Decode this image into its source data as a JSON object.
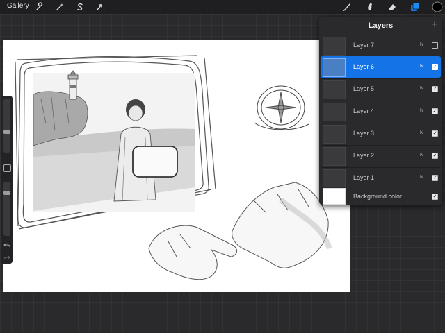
{
  "topbar": {
    "gallery_label": "Gallery",
    "left_tools": [
      {
        "name": "actions",
        "icon": "wrench-icon"
      },
      {
        "name": "adjustments",
        "icon": "magic-wand-icon"
      },
      {
        "name": "selection",
        "icon": "selection-s-icon"
      },
      {
        "name": "transform",
        "icon": "arrow-cursor-icon"
      }
    ],
    "right_tools": [
      {
        "name": "brush",
        "icon": "brush-icon"
      },
      {
        "name": "smudge",
        "icon": "smudge-icon"
      },
      {
        "name": "eraser",
        "icon": "eraser-icon"
      },
      {
        "name": "layers",
        "icon": "layers-icon",
        "active": true
      },
      {
        "name": "color",
        "icon": "color-swatch-icon",
        "color": "#000000"
      }
    ],
    "accent_color": "#1473e6"
  },
  "side_toolbar": {
    "brush_size_level": 0.38,
    "opacity_level": 0.82,
    "undo_icon": "undo-icon",
    "redo_icon": "redo-icon"
  },
  "layers_panel": {
    "title": "Layers",
    "add_icon": "plus-icon",
    "layers": [
      {
        "name": "Layer 7",
        "blend": "N",
        "visible": false,
        "active": false
      },
      {
        "name": "Layer 6",
        "blend": "N",
        "visible": true,
        "active": true
      },
      {
        "name": "Layer 5",
        "blend": "N",
        "visible": true,
        "active": false
      },
      {
        "name": "Layer 4",
        "blend": "N",
        "visible": true,
        "active": false
      },
      {
        "name": "Layer 3",
        "blend": "N",
        "visible": true,
        "active": false
      },
      {
        "name": "Layer 2",
        "blend": "N",
        "visible": true,
        "active": false
      },
      {
        "name": "Layer 1",
        "blend": "N",
        "visible": true,
        "active": false
      }
    ],
    "background": {
      "name": "Background color",
      "color": "#ffffff",
      "visible": true
    }
  }
}
